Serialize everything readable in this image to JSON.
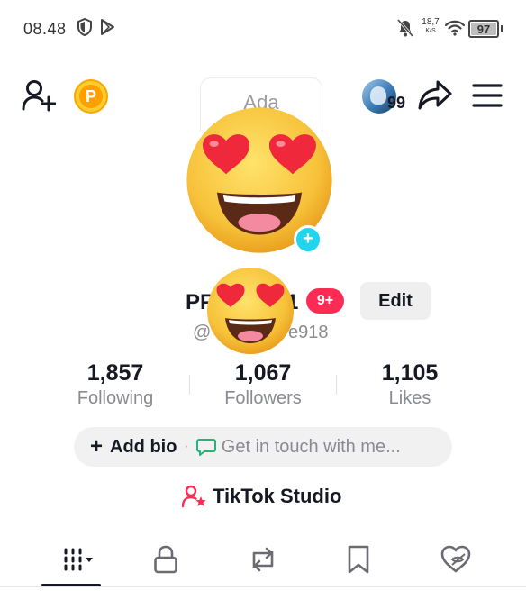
{
  "status_bar": {
    "time": "08.48",
    "net_speed": "18,7",
    "net_unit": "K/S",
    "battery_level": "97",
    "icons": [
      "shield-icon",
      "play-store-icon",
      "mute-icon",
      "wifi-icon",
      "battery-icon"
    ]
  },
  "top_bar": {
    "coin_letter": "P",
    "avatar_count": "99",
    "icons": [
      "add-friend-icon",
      "share-icon",
      "menu-icon"
    ]
  },
  "profile": {
    "card_text": "Ada",
    "name_visible_start": "PF",
    "name_visible_end": "1",
    "notification_badge": "9+",
    "edit_label": "Edit",
    "handle_visible_start": "@",
    "handle_visible_end": "e918",
    "plus_badge": "+"
  },
  "stats": [
    {
      "value": "1,857",
      "label": "Following"
    },
    {
      "value": "1,067",
      "label": "Followers"
    },
    {
      "value": "1,105",
      "label": "Likes"
    }
  ],
  "bio": {
    "add_label": "Add bio",
    "separator": "·",
    "contact_label": "Get in touch with me..."
  },
  "studio": {
    "label": "TikTok Studio"
  },
  "tabs": [
    {
      "name": "videos",
      "icon": "grid-icon",
      "active": true
    },
    {
      "name": "private",
      "icon": "lock-icon",
      "active": false
    },
    {
      "name": "reposts",
      "icon": "repost-icon",
      "active": false
    },
    {
      "name": "favorites",
      "icon": "bookmark-icon",
      "active": false
    },
    {
      "name": "liked",
      "icon": "heart-hidden-icon",
      "active": false
    }
  ],
  "colors": {
    "accent_red": "#fe2c55",
    "accent_cyan": "#20d5ec",
    "text_primary": "#161823",
    "text_secondary": "#8a8b91",
    "coin_yellow": "#ffcc2e"
  }
}
